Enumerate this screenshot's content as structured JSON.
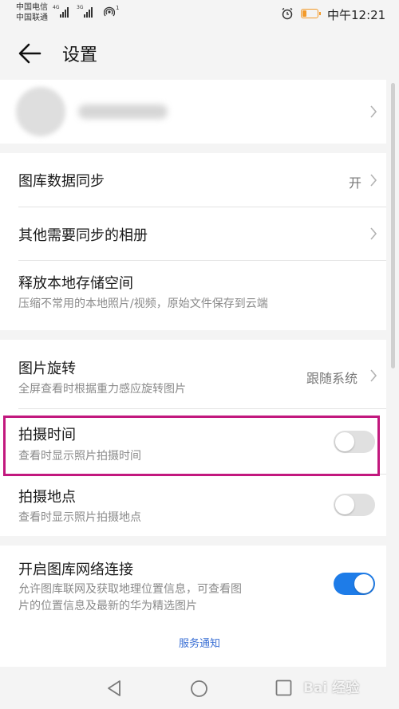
{
  "status_bar": {
    "carrier_1": "中国电信",
    "carrier_2": "中国联通",
    "network_1": "4G",
    "network_2": "3G",
    "hotspot_count": "1",
    "time": "中午12:21",
    "battery_color": "#f39a2a"
  },
  "app_bar": {
    "title": "设置",
    "back_icon": "arrow-left-icon"
  },
  "settings": {
    "gallery_sync": {
      "label": "图库数据同步",
      "value": "开"
    },
    "other_albums": {
      "label": "其他需要同步的相册"
    },
    "free_storage": {
      "label": "释放本地存储空间",
      "desc": "压缩不常用的本地照片/视频，原始文件保存到云端"
    },
    "rotation": {
      "label": "图片旋转",
      "desc": "全屏查看时根据重力感应旋转图片",
      "value": "跟随系统"
    },
    "shot_time": {
      "label": "拍摄时间",
      "desc": "查看时显示照片拍摄时间",
      "enabled": false
    },
    "shot_location": {
      "label": "拍摄地点",
      "desc": "查看时显示照片拍摄地点",
      "enabled": false
    },
    "network": {
      "label": "开启图库网络连接",
      "desc_line1": "允许图库联网及获取地理位置信息，可查看图",
      "desc_line2": "片的位置信息及最新的华为精选图片",
      "enabled": true
    }
  },
  "footer": {
    "service_link": "服务通知"
  },
  "nav_bar": {
    "back": "triangle-back-icon",
    "home": "circle-home-icon",
    "recents": "square-recents-icon"
  },
  "watermark": "Bai 经验",
  "colors": {
    "accent": "#1e7ce8",
    "highlight": "#c2187e"
  }
}
